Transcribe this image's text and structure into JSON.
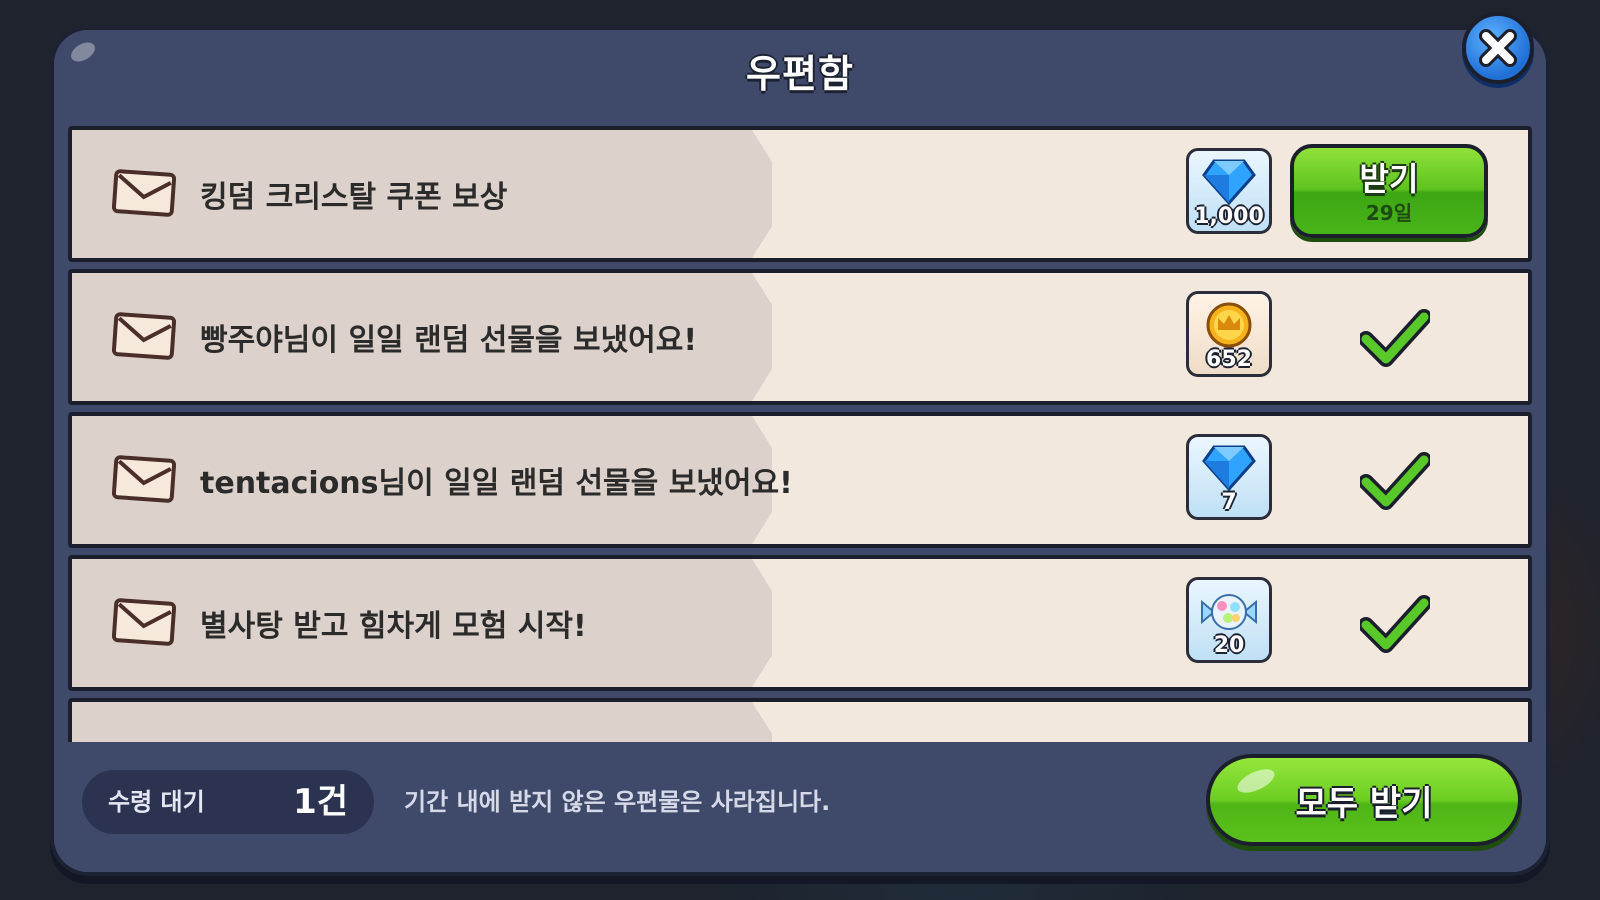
{
  "mailbox": {
    "title": "우편함",
    "messages": [
      {
        "text": "킹덤 크리스탈 쿠폰 보상",
        "reward_icon": "crystal-icon",
        "reward_count": "1,000",
        "status": "claimable",
        "claim_label": "받기",
        "expiry": "29일"
      },
      {
        "text": "빵주야님이 일일 랜덤 선물을 보냈어요!",
        "reward_icon": "coin-icon",
        "reward_count": "652",
        "status": "claimed"
      },
      {
        "text": "tentacions님이 일일 랜덤 선물을 보냈어요!",
        "reward_icon": "crystal-icon",
        "reward_count": "7",
        "status": "claimed"
      },
      {
        "text": "별사탕 받고 힘차게 모험 시작!",
        "reward_icon": "star-candy-icon",
        "reward_count": "20",
        "status": "claimed"
      }
    ],
    "footer": {
      "pending_label": "수령 대기",
      "pending_count": "1건",
      "notice": "기간 내에 받지 않은 우편물은 사라집니다.",
      "claim_all_label": "모두 받기"
    }
  },
  "colors": {
    "panel": "#3f4a6b",
    "row_bg": "#f3e8de",
    "button_green": "#5fc320",
    "close_blue": "#1f6fd6",
    "check_green": "#59c92a"
  }
}
